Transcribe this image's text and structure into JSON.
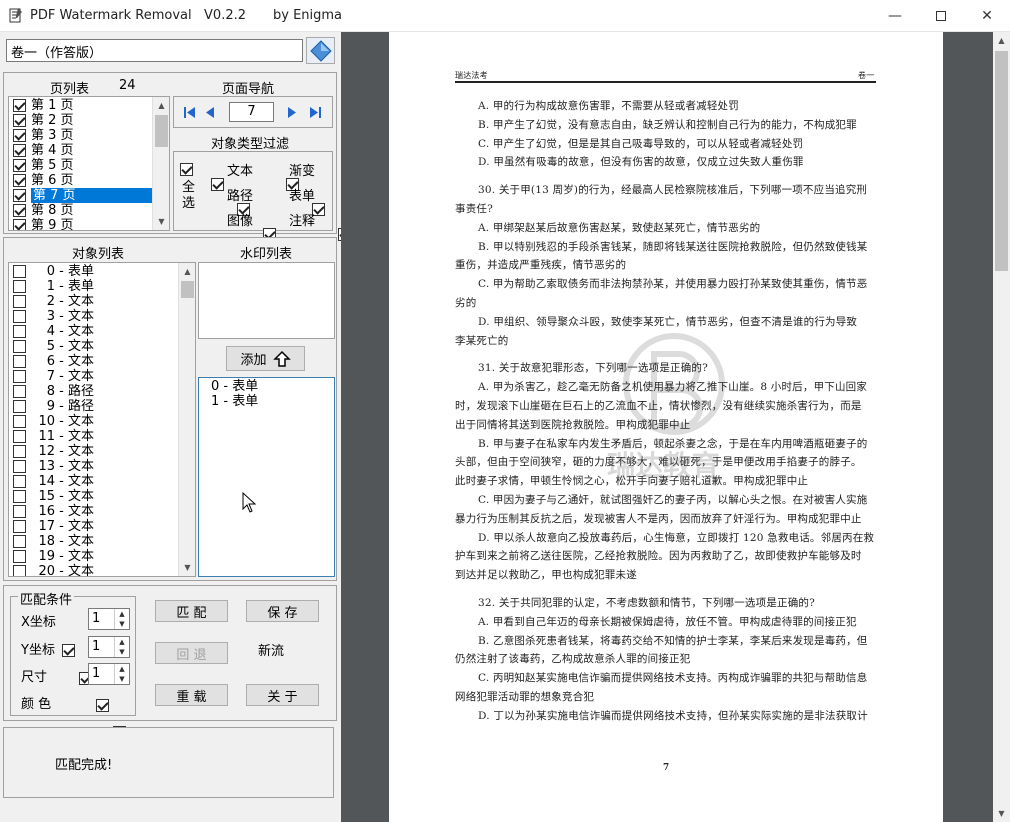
{
  "window": {
    "title": "PDF Watermark Removal   V0.2.2",
    "author": "by  Enigma"
  },
  "file": {
    "name": "卷一（作答版）"
  },
  "pages": {
    "header": "页列表",
    "count": "24",
    "items": [
      "第 1 页",
      "第 2 页",
      "第 3 页",
      "第 4 页",
      "第 5 页",
      "第 6 页",
      "第 7 页",
      "第 8 页",
      "第 9 页"
    ],
    "selected_index": 6
  },
  "nav": {
    "header": "页面导航",
    "current": "7"
  },
  "filter": {
    "header": "对象类型过滤",
    "select_all": "全选",
    "types": [
      "文本",
      "渐变",
      "路径",
      "表单",
      "图像",
      "注释"
    ]
  },
  "objects": {
    "header": "对象列表",
    "items": [
      "0 - 表单",
      "1 - 表单",
      "2 - 文本",
      "3 - 文本",
      "4 - 文本",
      "5 - 文本",
      "6 - 文本",
      "7 - 文本",
      "8 - 路径",
      "9 - 路径",
      "10 - 文本",
      "11 - 文本",
      "12 - 文本",
      "13 - 文本",
      "14 - 文本",
      "15 - 文本",
      "16 - 文本",
      "17 - 文本",
      "18 - 文本",
      "19 - 文本",
      "20 - 文本"
    ]
  },
  "watermark": {
    "header": "水印列表",
    "add_label": "添加",
    "items": [
      "0 - 表单",
      "1 - 表单"
    ]
  },
  "match": {
    "header": "匹配条件",
    "x_label": "X坐标",
    "y_label": "Y坐标",
    "size_label": "尺寸",
    "color_label": "颜 色",
    "x_val": "1",
    "y_val": "1",
    "size_val": "1",
    "match_btn": "匹 配",
    "save_btn": "保 存",
    "undo_btn": "回 退",
    "newstream_label": "新流",
    "reload_btn": "重 载",
    "about_btn": "关 于"
  },
  "status": {
    "text": "匹配完成!"
  },
  "document": {
    "header_left": "瑞达法考",
    "header_right": "卷一",
    "watermark_text": "瑞达教育",
    "page_number": "7",
    "lines": [
      "A. 甲的行为构成故意伤害罪，不需要从轻或者减轻处罚",
      "B. 甲产生了幻觉，没有意志自由，缺乏辨认和控制自己行为的能力，不构成犯罪",
      "C. 甲产生了幻觉，但是是其自己吸毒导致的，可以从轻或者减轻处罚",
      "D. 甲虽然有吸毒的故意，但没有伤害的故意，仅成立过失致人重伤罪",
      "",
      "30. 关于甲(13 周岁)的行为，经最高人民检察院核准后，下列哪一项不应当追究刑",
      "事责任?",
      "A. 甲绑架赵某后故意伤害赵某，致使赵某死亡，情节恶劣的",
      "B. 甲以特别残忍的手段杀害钱某，随即将钱某送往医院抢救脱险，但仍然致使钱某",
      "重伤，并造成严重残疾，情节恶劣的",
      "C. 甲为帮助乙索取债务而非法拘禁孙某，并使用暴力殴打孙某致使其重伤，情节恶",
      "劣的",
      "D. 甲组织、领导聚众斗殴，致使李某死亡，情节恶劣，但查不清是谁的行为导致",
      "李某死亡的",
      "",
      "31. 关于故意犯罪形态，下列哪一选项是正确的?",
      "A. 甲为杀害乙，趁乙毫无防备之机使用暴力将乙推下山崖。8 小时后，甲下山回家",
      "时，发现滚下山崖砸在巨石上的乙流血不止，情状惨烈，没有继续实施杀害行为，而是",
      "出于同情将其送到医院抢救脱险。甲构成犯罪中止",
      "B. 甲与妻子在私家车内发生矛盾后，顿起杀妻之念，于是在车内用啤酒瓶砸妻子的",
      "头部，但由于空间狭窄，砸的力度不够大，难以砸死，于是甲便改用手掐妻子的脖子。",
      "此时妻子求情，甲顿生怜悯之心，松开手向妻子赔礼道歉。甲构成犯罪中止",
      "C. 甲因为妻子与乙通奸，就试图强奸乙的妻子丙，以解心头之恨。在对被害人实施",
      "暴力行为压制其反抗之后，发现被害人不是丙，因而放弃了奸淫行为。甲构成犯罪中止",
      "D. 甲以杀人故意向乙投放毒药后，心生悔意，立即拨打 120 急救电话。邻居丙在救",
      "护车到来之前将乙送往医院，乙经抢救脱险。因为丙救助了乙，故即使救护车能够及时",
      "到达并足以救助乙，甲也构成犯罪未遂",
      "",
      "32. 关于共同犯罪的认定，不考虑数额和情节，下列哪一选项是正确的?",
      "A. 甲看到自己年迈的母亲长期被保姆虐待，放任不管。甲构成虐待罪的间接正犯",
      "B. 乙意图杀死患者钱某，将毒药交给不知情的护士李某，李某后来发现是毒药，但",
      "仍然注射了该毒药，乙构成故意杀人罪的间接正犯",
      "C. 丙明知赵某实施电信诈骗而提供网络技术支持。丙构成诈骗罪的共犯与帮助信息",
      "网络犯罪活动罪的想象竞合犯",
      "D. 丁以为孙某实施电信诈骗而提供网络技术支持，但孙某实际实施的是非法获取计"
    ]
  }
}
